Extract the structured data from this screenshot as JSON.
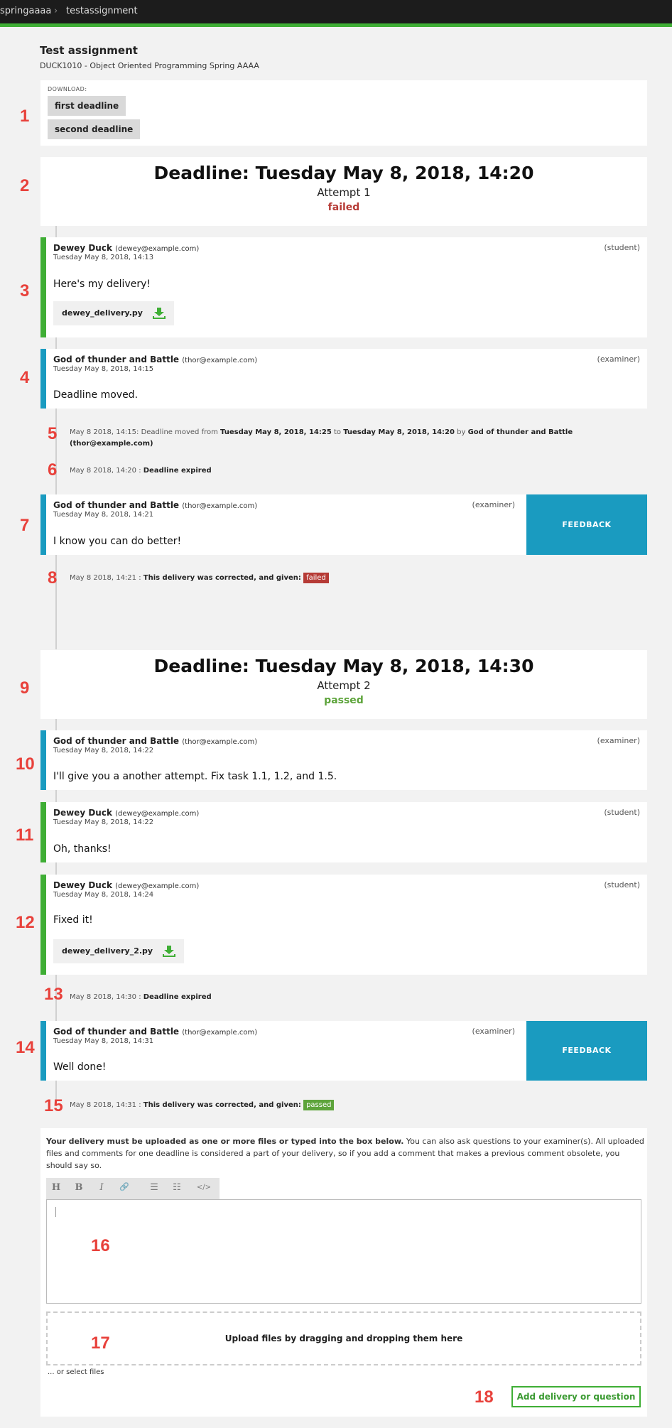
{
  "breadcrumb": {
    "parent": "springaaaa",
    "current": "testassignment"
  },
  "assignment": {
    "title": "Test assignment",
    "course": "DUCK1010 - Object Oriented Programming Spring AAAA"
  },
  "download": {
    "label": "DOWNLOAD:",
    "buttons": [
      "first deadline",
      "second deadline"
    ]
  },
  "markers": [
    "1",
    "2",
    "3",
    "4",
    "5",
    "6",
    "7",
    "8",
    "9",
    "10",
    "11",
    "12",
    "13",
    "14",
    "15",
    "16",
    "17",
    "18"
  ],
  "deadline1": {
    "title": "Deadline: Tuesday May 8, 2018, 14:20",
    "attempt": "Attempt 1",
    "status": "failed"
  },
  "deadline2": {
    "title": "Deadline: Tuesday May 8, 2018, 14:30",
    "attempt": "Attempt 2",
    "status": "passed"
  },
  "messages": [
    {
      "author": "Dewey Duck",
      "email": "(dewey@example.com)",
      "date": "Tuesday May 8, 2018, 14:13",
      "role": "(student)",
      "text": "Here's my delivery!",
      "file": "dewey_delivery.py"
    },
    {
      "author": "God of thunder and Battle",
      "email": "(thor@example.com)",
      "date": "Tuesday May 8, 2018, 14:15",
      "role": "(examiner)",
      "text": "Deadline moved."
    },
    {
      "author": "God of thunder and Battle",
      "email": "(thor@example.com)",
      "date": "Tuesday May 8, 2018, 14:21",
      "role": "(examiner)",
      "text": "I know you can do better!",
      "feedback": "FEEDBACK"
    },
    {
      "author": "God of thunder and Battle",
      "email": "(thor@example.com)",
      "date": "Tuesday May 8, 2018, 14:22",
      "role": "(examiner)",
      "text": "I'll give you a another attempt. Fix task 1.1, 1.2, and 1.5."
    },
    {
      "author": "Dewey Duck",
      "email": "(dewey@example.com)",
      "date": "Tuesday May 8, 2018, 14:22",
      "role": "(student)",
      "text": "Oh, thanks!"
    },
    {
      "author": "Dewey Duck",
      "email": "(dewey@example.com)",
      "date": "Tuesday May 8, 2018, 14:24",
      "role": "(student)",
      "text": "Fixed it!",
      "file": "dewey_delivery_2.py"
    },
    {
      "author": "God of thunder and Battle",
      "email": "(thor@example.com)",
      "date": "Tuesday May 8, 2018, 14:31",
      "role": "(examiner)",
      "text": "Well done!",
      "feedback": "FEEDBACK"
    }
  ],
  "events": {
    "moved": {
      "prefix": "May 8 2018, 14:15: Deadline moved from ",
      "from": "Tuesday May 8, 2018, 14:25",
      "mid": " to ",
      "to": "Tuesday May 8, 2018, 14:20",
      "by": " by ",
      "who": "God of thunder and Battle",
      "email": "(thor@example.com)"
    },
    "expired1": {
      "time": "May 8 2018, 14:20 : ",
      "text": "Deadline expired"
    },
    "corrected1": {
      "time": "May 8 2018, 14:21 : ",
      "text": "This delivery was corrected, and given:",
      "grade": "failed"
    },
    "expired2": {
      "time": "May 8 2018, 14:30 : ",
      "text": "Deadline expired"
    },
    "corrected2": {
      "time": "May 8 2018, 14:31 : ",
      "text": "This delivery was corrected, and given:",
      "grade": "passed"
    }
  },
  "composer": {
    "instructions_bold": "Your delivery must be uploaded as one or more files or typed into the box below.",
    "instructions_rest": " You can also ask questions to your examiner(s). All uploaded files and comments for one deadline is considered a part of your delivery, so if you add a comment that makes a previous comment obsolete, you should say so.",
    "toolbar": [
      "H",
      "B",
      "I",
      "🔗",
      "☰",
      "☷",
      "</>"
    ],
    "dropzone": "Upload files by dragging and dropping them here",
    "select_files": "... or select files",
    "submit": "Add delivery or question"
  },
  "colors": {
    "student": "#3fae35",
    "examiner": "#1a9bc0",
    "failed": "#b63b36",
    "passed": "#5da43b",
    "marker": "#e8413b"
  }
}
